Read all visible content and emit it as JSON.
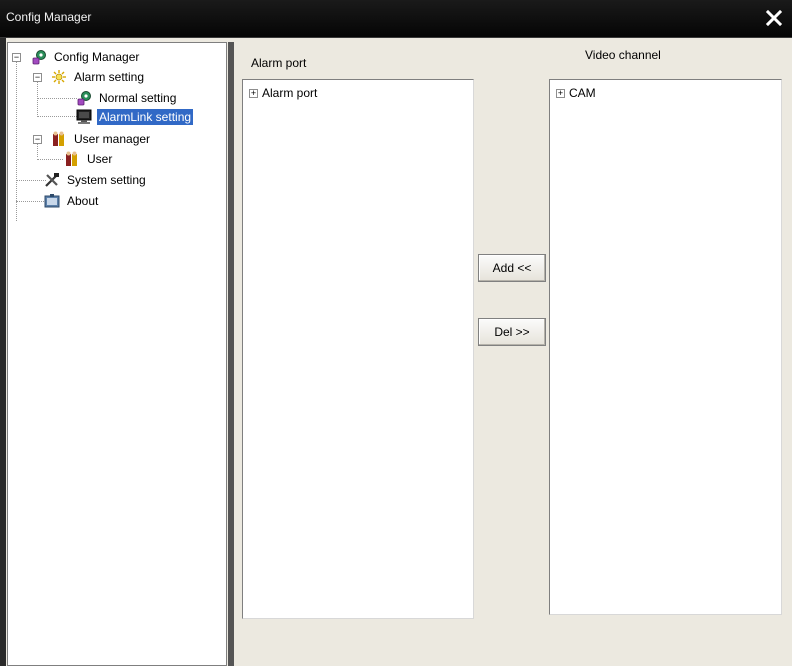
{
  "window": {
    "title": "Config Manager",
    "close_glyph": "✕"
  },
  "tree": {
    "root": {
      "label": "Config Manager",
      "icon": "config-gear-icon",
      "toggle": "−"
    },
    "alarm_setting": {
      "label": "Alarm setting",
      "icon": "alarm-light-icon",
      "toggle": "−"
    },
    "normal_setting": {
      "label": "Normal setting",
      "icon": "config-gear-icon"
    },
    "alarmlink_setting": {
      "label": "AlarmLink setting",
      "icon": "monitor-icon"
    },
    "user_manager": {
      "label": "User manager",
      "icon": "user-group-icon",
      "toggle": "−"
    },
    "user": {
      "label": "User",
      "icon": "user-group-icon"
    },
    "system_setting": {
      "label": "System setting",
      "icon": "tools-icon"
    },
    "about": {
      "label": "About",
      "icon": "about-icon"
    }
  },
  "alarm_panel": {
    "header": "Alarm port",
    "item_label": "Alarm port",
    "toggle": "+"
  },
  "video_panel": {
    "header": "Video channel",
    "item_label": "CAM",
    "toggle": "+"
  },
  "buttons": {
    "add": "Add <<",
    "del": "Del >>"
  },
  "colors": {
    "selection": "#3169c6",
    "titlebar": "#0a0a0a",
    "panel_bg": "#ece9e0"
  }
}
